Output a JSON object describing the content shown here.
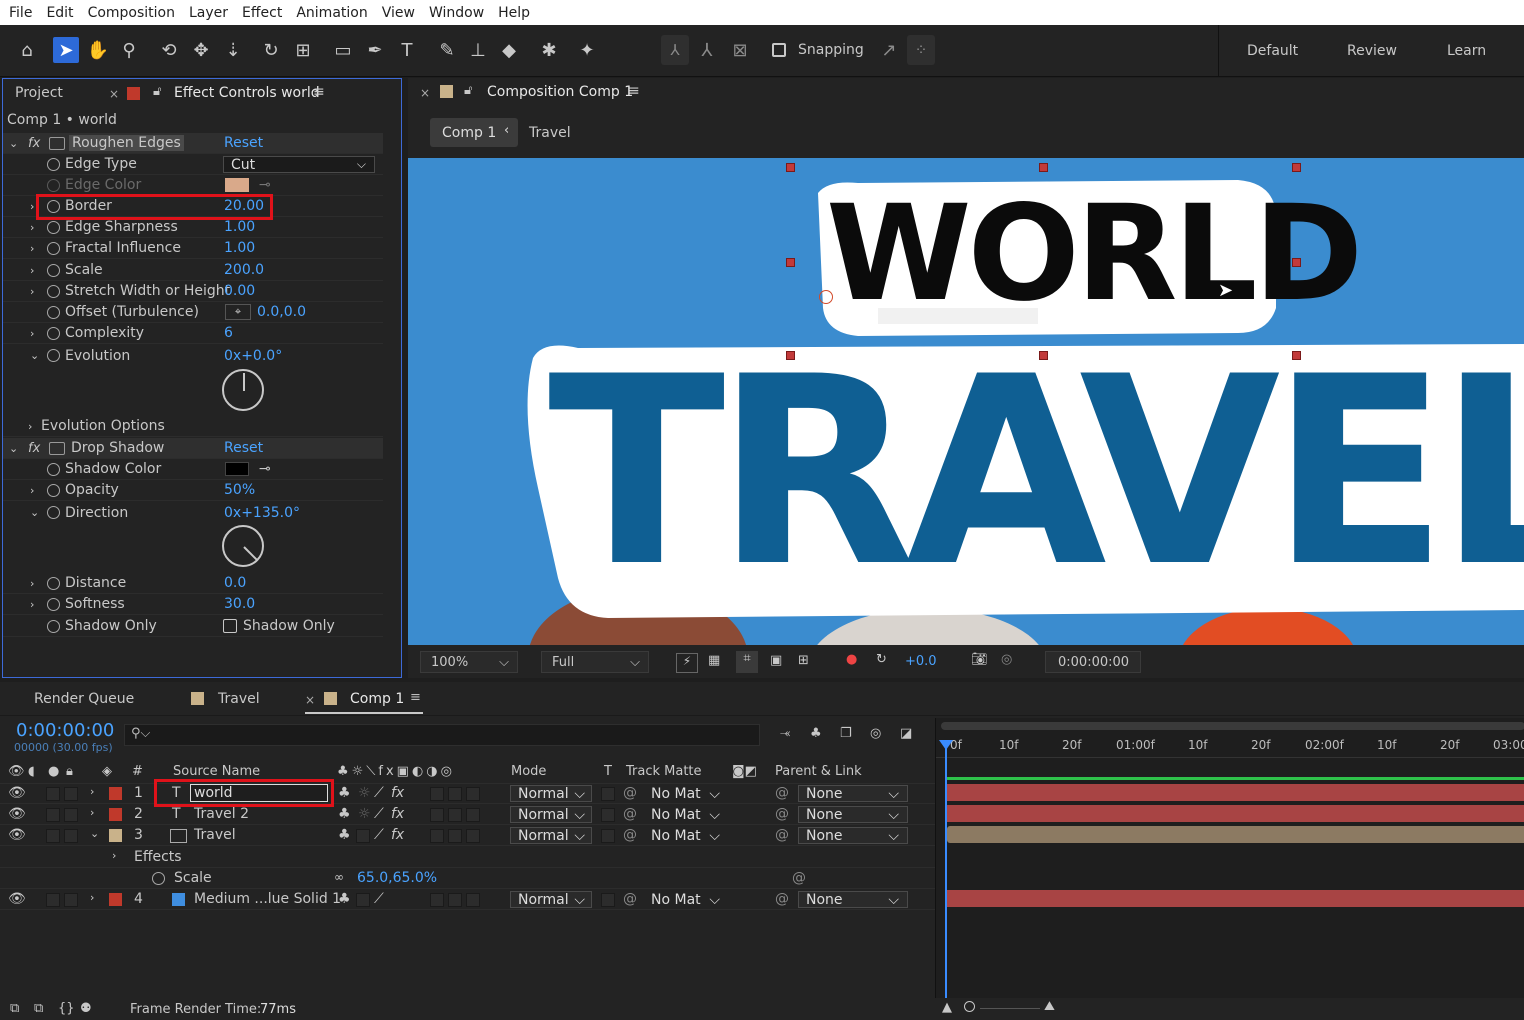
{
  "menu": [
    "File",
    "Edit",
    "Composition",
    "Layer",
    "Effect",
    "Animation",
    "View",
    "Window",
    "Help"
  ],
  "toolbar": {
    "snapping_label": "Snapping",
    "workspaces": [
      "Default",
      "Review",
      "Learn"
    ]
  },
  "effect_controls": {
    "tab_project": "Project",
    "tab_ec": "Effect Controls world",
    "subtitle": "Comp 1 • world",
    "roughen": {
      "name": "Roughen Edges",
      "reset": "Reset",
      "edge_type_label": "Edge Type",
      "edge_type_value": "Cut",
      "edge_color_label": "Edge Color",
      "border_label": "Border",
      "border_value": "20.00",
      "sharpness_label": "Edge Sharpness",
      "sharpness_value": "1.00",
      "fractal_label": "Fractal Influence",
      "fractal_value": "1.00",
      "scale_label": "Scale",
      "scale_value": "200.0",
      "stretch_label": "Stretch Width or Height",
      "stretch_value": "0.00",
      "offset_label": "Offset (Turbulence)",
      "offset_value": "0.0,0.0",
      "complexity_label": "Complexity",
      "complexity_value": "6",
      "evolution_label": "Evolution",
      "evolution_value": "0x+0.0°",
      "evo_options_label": "Evolution Options"
    },
    "shadow": {
      "name": "Drop Shadow",
      "reset": "Reset",
      "color_label": "Shadow Color",
      "opacity_label": "Opacity",
      "opacity_value": "50%",
      "direction_label": "Direction",
      "direction_value": "0x+135.0°",
      "distance_label": "Distance",
      "distance_value": "0.0",
      "softness_label": "Softness",
      "softness_value": "30.0",
      "only_label": "Shadow Only",
      "only_checkbox": "Shadow Only"
    }
  },
  "composition": {
    "tab_title": "Composition Comp 1",
    "breadcrumb_active": "Comp 1",
    "breadcrumb_next": "Travel",
    "artwork_world": "WORLD",
    "artwork_travel": "TRAVEL",
    "zoom": "100%",
    "resolution": "Full",
    "exposure": "+0.0",
    "timecode": "0:00:00:00"
  },
  "timeline": {
    "tab_render": "Render Queue",
    "tab_travel": "Travel",
    "tab_comp": "Comp 1",
    "timecode": "0:00:00:00",
    "frame_info": "00000 (30.00 fps)",
    "columns": {
      "num": "#",
      "source": "Source Name",
      "mode": "Mode",
      "t": "T",
      "matte": "Track Matte",
      "parent": "Parent & Link"
    },
    "ruler": [
      "0f",
      "10f",
      "20f",
      "01:00f",
      "10f",
      "20f",
      "02:00f",
      "10f",
      "20f",
      "03:00"
    ],
    "layers": [
      {
        "num": "1",
        "name": "world",
        "mode": "Normal",
        "matte": "No Mat",
        "parent": "None"
      },
      {
        "num": "2",
        "name": "Travel 2",
        "mode": "Normal",
        "matte": "No Mat",
        "parent": "None"
      },
      {
        "num": "3",
        "name": "Travel",
        "mode": "Normal",
        "matte": "No Mat",
        "parent": "None"
      },
      {
        "num": "4",
        "name": "Medium ...lue Solid 1",
        "mode": "Normal",
        "matte": "No Mat",
        "parent": "None"
      }
    ],
    "effects_label": "Effects",
    "scale_label": "Scale",
    "scale_value": "65.0,65.0%"
  },
  "status": {
    "frame_render_label": "Frame Render Time:",
    "frame_render_value": "77ms"
  },
  "colors": {
    "accent": "#2d6ad8",
    "value_blue": "#4aa3ff",
    "label_red": "#c0392b",
    "highlight": "#e0121a",
    "sky": "#3b8ccf",
    "travel_text": "#0f5f93"
  }
}
